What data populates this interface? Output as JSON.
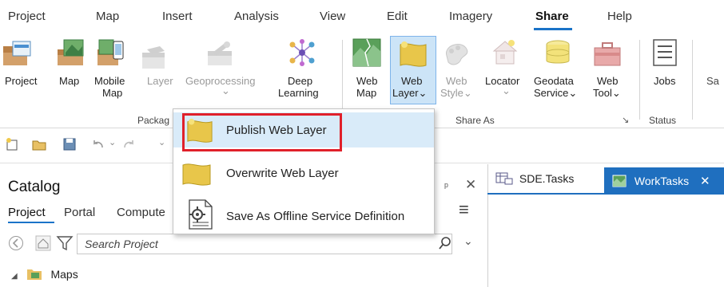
{
  "ribbon_tabs": [
    {
      "label": "Project"
    },
    {
      "label": "Map"
    },
    {
      "label": "Insert"
    },
    {
      "label": "Analysis"
    },
    {
      "label": "View"
    },
    {
      "label": "Edit"
    },
    {
      "label": "Imagery"
    },
    {
      "label": "Share"
    },
    {
      "label": "Help"
    }
  ],
  "active_tab": "Share",
  "ribbon": {
    "project": "Project",
    "map": "Map",
    "mobile_map_1": "Mobile",
    "mobile_map_2": "Map",
    "layer": "Layer",
    "geoprocessing": "Geoprocessing",
    "geoprocessing_caret": "⌄",
    "deep_learning_1": "Deep",
    "deep_learning_2": "Learning",
    "web_map_1": "Web",
    "web_map_2": "Map",
    "web_layer_1": "Web",
    "web_layer_2": "Layer",
    "web_style_1": "Web",
    "web_style_2": "Style",
    "locator_1": "Locator",
    "locator_caret": "⌄",
    "geodata_1": "Geodata",
    "geodata_2": "Service",
    "web_tool_1": "Web",
    "web_tool_2": "Tool",
    "jobs": "Jobs",
    "sa": "Sa",
    "group_package": "Packag",
    "group_share_as": "Share As",
    "group_status": "Status",
    "caret": "⌄"
  },
  "dropdown": {
    "items": [
      {
        "label": "Publish Web Layer"
      },
      {
        "label": "Overwrite Web Layer"
      },
      {
        "label": "Save As Offline Service Definition"
      }
    ]
  },
  "catalog": {
    "title": "Catalog",
    "tabs": [
      {
        "label": "Project"
      },
      {
        "label": "Portal"
      },
      {
        "label": "Compute"
      }
    ],
    "search_placeholder": "Search Project",
    "tree": [
      {
        "label": "Maps"
      }
    ],
    "pin_glyph": "ᵖ",
    "close_glyph": "✕",
    "menu_glyph": "≡",
    "search_glyph": "⌕",
    "caret": "⌄"
  },
  "doc_tabs": [
    {
      "label": "SDE.Tasks"
    },
    {
      "label": "WorkTasks"
    }
  ],
  "colors": {
    "accent": "#1a73c8",
    "highlight": "#d9ebf9",
    "callout": "#e0202a",
    "active_doc_tab": "#1f6fbf"
  }
}
